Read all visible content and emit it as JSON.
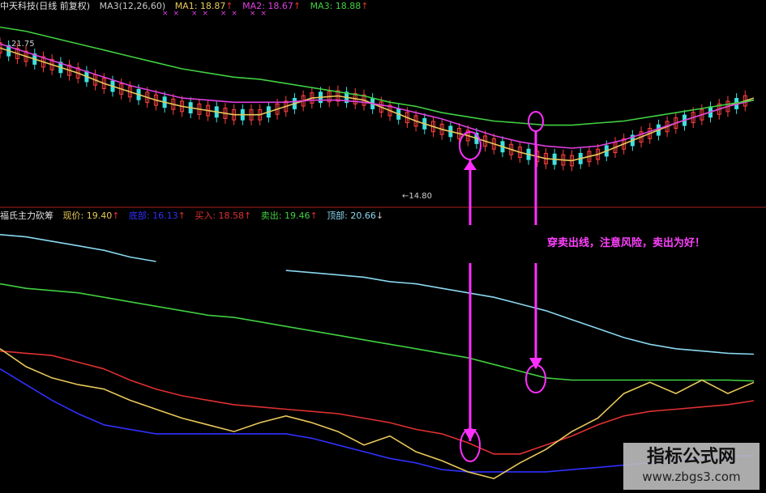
{
  "top_header": {
    "stock": "中天科技(日线 前复权)",
    "ma_set": "MA3(12,26,60)",
    "ma1": {
      "label": "MA1: 18.87",
      "arrow": "↑",
      "color": "#e8c85a"
    },
    "ma2": {
      "label": "MA2: 18.67",
      "arrow": "↑",
      "color": "#e040e0"
    },
    "ma3": {
      "label": "MA3: 18.88",
      "arrow": "↑",
      "color": "#40d040"
    },
    "marks": "×× ×× ×× ××"
  },
  "bottom_header": {
    "indicator": "福氏主力砍筹",
    "price": {
      "label": "现价: 19.40",
      "arrow": "↑",
      "color": "#e8c85a"
    },
    "bottom": {
      "label": "底部: 16.13",
      "arrow": "↑",
      "color": "#3030ff"
    },
    "buy": {
      "label": "买入: 18.58",
      "arrow": "↑",
      "color": "#e03030"
    },
    "sell": {
      "label": "卖出: 19.46",
      "arrow": "↑",
      "color": "#40d040"
    },
    "top": {
      "label": "顶部: 20.66",
      "arrow": "↓",
      "color": "#8ad8f0"
    }
  },
  "annotations": {
    "high_label": "21.75",
    "low_label": "←14.80",
    "note": "穿卖出线，注意风险，卖出为好！"
  },
  "watermark": {
    "title": "指标公式网",
    "url": "www.zbgs3.com"
  },
  "chart_data": [
    {
      "type": "line",
      "panel": "price",
      "series": [
        {
          "name": "MA1",
          "color": "#e8c85a",
          "values": [
            21.4,
            21.0,
            20.6,
            20.2,
            19.7,
            19.3,
            18.9,
            18.6,
            18.4,
            18.2,
            18.2,
            18.6,
            19.0,
            19.1,
            18.9,
            18.4,
            17.9,
            17.5,
            17.2,
            16.8,
            16.4,
            16.1,
            16.0,
            16.3,
            16.8,
            17.3,
            17.8,
            18.2,
            18.6,
            19.0
          ]
        },
        {
          "name": "MA2",
          "color": "#e040e0",
          "values": [
            21.6,
            21.2,
            20.8,
            20.4,
            20.0,
            19.6,
            19.3,
            19.0,
            18.9,
            18.8,
            18.8,
            18.8,
            18.9,
            18.9,
            18.8,
            18.6,
            18.3,
            18.0,
            17.6,
            17.2,
            16.9,
            16.7,
            16.6,
            16.7,
            17.0,
            17.4,
            17.8,
            18.2,
            18.6,
            18.9
          ]
        },
        {
          "name": "MA3",
          "color": "#40d040",
          "values": [
            22.4,
            22.2,
            21.9,
            21.6,
            21.3,
            21.0,
            20.7,
            20.4,
            20.2,
            20.0,
            19.9,
            19.7,
            19.5,
            19.3,
            19.1,
            18.8,
            18.6,
            18.3,
            18.1,
            17.9,
            17.8,
            17.7,
            17.7,
            17.8,
            17.9,
            18.1,
            18.3,
            18.5,
            18.7,
            18.9
          ]
        }
      ]
    },
    {
      "type": "line",
      "panel": "indicator",
      "series": [
        {
          "name": "顶部",
          "color": "#8ad8f0",
          "values": [
            26.0,
            25.9,
            25.7,
            25.5,
            25.3,
            25.0,
            24.8,
            null,
            null,
            null,
            null,
            24.4,
            24.3,
            24.2,
            24.1,
            23.9,
            23.8,
            23.6,
            23.4,
            23.2,
            22.9,
            22.6,
            22.2,
            21.8,
            21.4,
            21.1,
            20.9,
            20.8,
            20.7,
            20.66
          ]
        },
        {
          "name": "卖出",
          "color": "#40d040",
          "values": [
            23.8,
            23.6,
            23.5,
            23.4,
            23.2,
            23.0,
            22.8,
            22.6,
            22.4,
            22.3,
            22.1,
            21.9,
            21.7,
            21.5,
            21.3,
            21.1,
            20.9,
            20.7,
            20.5,
            20.2,
            19.9,
            19.6,
            19.5,
            19.5,
            19.5,
            19.5,
            19.5,
            19.5,
            19.5,
            19.46
          ]
        },
        {
          "name": "买入",
          "color": "#e03030",
          "values": [
            20.8,
            20.7,
            20.6,
            20.3,
            20.0,
            19.5,
            19.1,
            18.8,
            18.6,
            18.4,
            18.3,
            18.2,
            18.1,
            18.0,
            17.8,
            17.6,
            17.3,
            17.1,
            16.7,
            16.2,
            16.2,
            16.6,
            17.0,
            17.5,
            17.9,
            18.1,
            18.2,
            18.3,
            18.4,
            18.58
          ]
        },
        {
          "name": "底部",
          "color": "#3030ff",
          "values": [
            20.0,
            19.3,
            18.6,
            18.0,
            17.5,
            17.3,
            17.1,
            17.1,
            17.1,
            17.1,
            17.1,
            17.1,
            16.9,
            16.6,
            16.3,
            16.0,
            15.8,
            15.5,
            15.4,
            15.4,
            15.4,
            15.4,
            15.5,
            15.6,
            15.7,
            15.8,
            15.9,
            16.0,
            16.1,
            16.13
          ]
        },
        {
          "name": "现价",
          "color": "#e8c85a",
          "values": [
            20.9,
            20.1,
            19.6,
            19.3,
            19.1,
            18.6,
            18.2,
            17.8,
            17.5,
            17.2,
            17.6,
            17.9,
            17.6,
            17.2,
            16.6,
            17.0,
            16.3,
            15.9,
            15.4,
            15.1,
            15.8,
            16.4,
            17.2,
            17.8,
            18.9,
            19.4,
            18.9,
            19.5,
            18.9,
            19.4
          ]
        }
      ]
    }
  ]
}
